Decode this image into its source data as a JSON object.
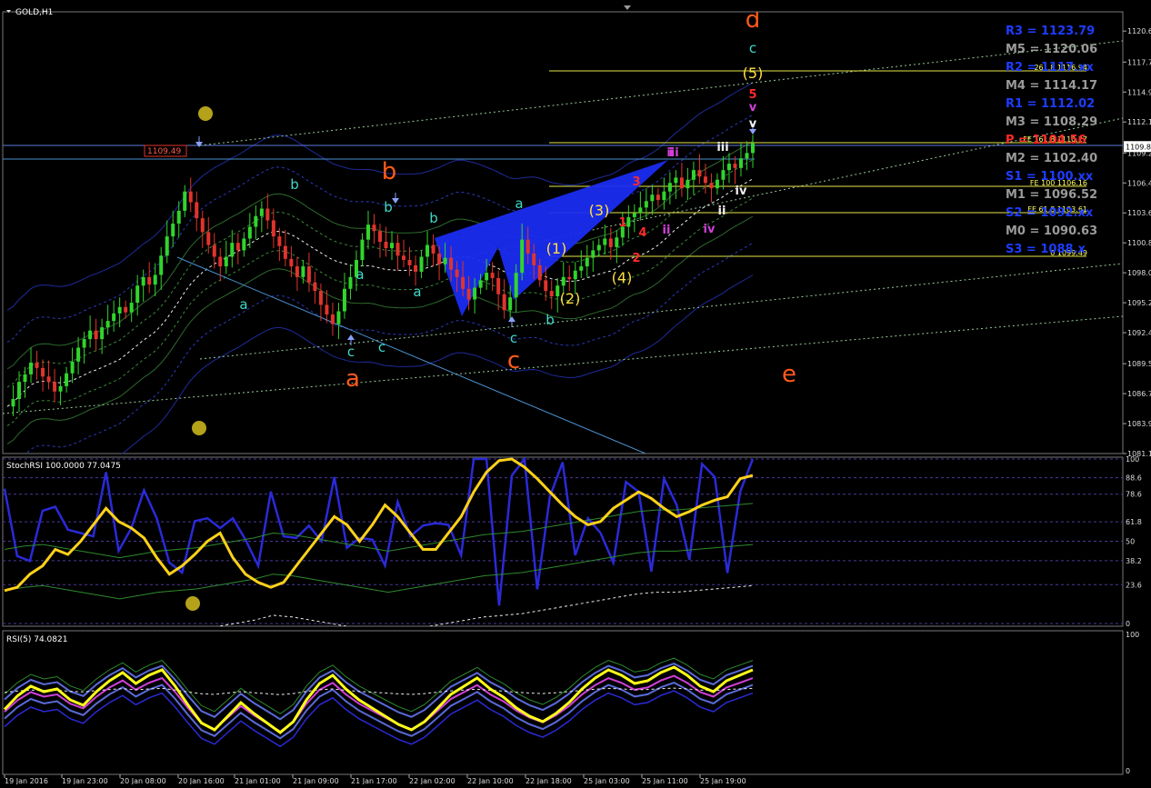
{
  "window": {
    "title": "GOLD,H1"
  },
  "chart_data": [
    {
      "type": "candlestick",
      "title": "GOLD,H1",
      "ylim": [
        1081.1,
        1122.4
      ],
      "y_ticks": [
        "1120.6",
        "1117.7",
        "1114.9",
        "1112.1",
        "1109.2",
        "1106.4",
        "1103.6",
        "1100.8",
        "1098.0",
        "1095.2",
        "1092.4",
        "1089.5",
        "1086.7",
        "1083.9",
        "1081.1"
      ],
      "current_price": "1109.8",
      "x_ticks": [
        "19 Jan 2016",
        "19 Jan 23:00",
        "20 Jan 08:00",
        "20 Jan 16:00",
        "21 Jan 01:00",
        "21 Jan 09:00",
        "21 Jan 17:00",
        "22 Jan 02:00",
        "22 Jan 10:00",
        "22 Jan 18:00",
        "25 Jan 03:00",
        "25 Jan 11:00",
        "25 Jan 19:00"
      ],
      "close_series": [
        1085.5,
        1086.2,
        1087.8,
        1088.5,
        1089.6,
        1089.1,
        1088.3,
        1087.8,
        1086.9,
        1087.4,
        1088.6,
        1089.7,
        1091.0,
        1091.8,
        1092.6,
        1091.8,
        1092.9,
        1093.5,
        1094.2,
        1094.8,
        1094.3,
        1095.2,
        1096.8,
        1097.6,
        1096.9,
        1097.8,
        1099.6,
        1101.4,
        1102.6,
        1103.8,
        1105.6,
        1104.6,
        1103.1,
        1101.8,
        1100.6,
        1099.5,
        1098.6,
        1099.5,
        1100.8,
        1100.1,
        1101.2,
        1102.3,
        1103.3,
        1104.0,
        1102.9,
        1101.4,
        1100.5,
        1099.3,
        1098.6,
        1097.6,
        1098.6,
        1097.1,
        1096.3,
        1095.0,
        1094.1,
        1093.2,
        1094.4,
        1096.5,
        1097.6,
        1099.2,
        1101.1,
        1102.5,
        1101.9,
        1100.9,
        1100.3,
        1100.8,
        1099.6,
        1099.2,
        1098.7,
        1098.1,
        1099.5,
        1100.6,
        1099.8,
        1098.8,
        1099.4,
        1098.3,
        1097.6,
        1096.5,
        1095.5,
        1096.6,
        1097.3,
        1098.0,
        1097.5,
        1096.0,
        1094.5,
        1095.7,
        1098.0,
        1101.1,
        1099.8,
        1098.7,
        1097.3,
        1096.3,
        1095.8,
        1096.8,
        1097.6,
        1097.4,
        1098.2,
        1098.6,
        1099.4,
        1100.1,
        1100.6,
        1101.2,
        1100.4,
        1101.3,
        1102.3,
        1103.2,
        1103.6,
        1104.1,
        1104.7,
        1105.3,
        1104.8,
        1105.6,
        1106.4,
        1106.9,
        1105.9,
        1106.7,
        1107.6,
        1107.0,
        1106.4,
        1105.9,
        1106.7,
        1107.6,
        1108.2,
        1107.8,
        1108.7,
        1109.2,
        1110.1
      ],
      "pivots": [
        "R3 = 1123.79",
        "M5 = 1120.06",
        "R2 = 1117.xx",
        "M4 = 1114.17",
        "R1 = 1112.02",
        "M3 = 1108.29",
        "P = 1104.56",
        "M2 = 1102.40",
        "S1 = 1100.xx",
        "M1 = 1096.52",
        "S2 = 1092.xx",
        "M0 = 1090.63",
        "S3 = 1088.x"
      ],
      "fib_levels": [
        "261.8 1116.94",
        "FE 161.8 1110.27",
        "FE 100 1106.16",
        "FE 61.8 1103.61",
        "0 1099.49"
      ],
      "price_tag": "1109.49",
      "wave_labels_major": [
        "a",
        "b",
        "c",
        "d",
        "e"
      ],
      "wave_labels_minor": [
        "a",
        "b",
        "c",
        "a",
        "b",
        "c",
        "a",
        "b",
        "c",
        "a",
        "b",
        "c"
      ],
      "wave_labels_impulse": [
        "(1)",
        "(2)",
        "(3)",
        "(4)",
        "(5)"
      ],
      "wave_labels_red": [
        "1",
        "2",
        "3",
        "4",
        "5"
      ],
      "wave_labels_roman": [
        "i",
        "ii",
        "iii",
        "iv",
        "v",
        "ii",
        "iii",
        "iv",
        "v"
      ]
    },
    {
      "type": "line",
      "title": "StochRSI 100.0000 77.0475",
      "ylim": [
        0,
        100
      ],
      "y_ticks": [
        "100",
        "88.6",
        "78.6",
        "61.8",
        "50",
        "38.2",
        "23.6",
        "0"
      ],
      "series": [
        {
          "values": [
            20,
            22,
            30,
            35,
            45,
            42,
            50,
            60,
            70,
            62,
            58,
            52,
            40,
            30,
            35,
            42,
            50,
            55,
            40,
            30,
            25,
            22,
            25,
            35,
            45,
            55,
            65,
            60,
            50,
            60,
            72,
            65,
            55,
            45,
            45,
            55,
            65,
            80,
            92,
            99,
            100,
            95,
            88,
            80,
            72,
            65,
            60,
            62,
            70,
            75,
            80,
            76,
            70,
            65,
            68,
            72,
            75,
            77,
            88,
            90
          ]
        },
        {
          "values": [
            65,
            67,
            68,
            66,
            64,
            62,
            60,
            62,
            64,
            65,
            66,
            68,
            70,
            72,
            75,
            74,
            72,
            70,
            68,
            66,
            64,
            66,
            68,
            70,
            72,
            74,
            75,
            76,
            78,
            80,
            82,
            84,
            86,
            88,
            89,
            89,
            90,
            91,
            92,
            93
          ]
        }
      ]
    },
    {
      "type": "line",
      "title": "RSI(5) 74.0821",
      "ylim": [
        0,
        100
      ],
      "y_ticks": [
        "100",
        "0"
      ],
      "series": [
        {
          "values": [
            45,
            55,
            62,
            58,
            60,
            52,
            48,
            58,
            66,
            72,
            64,
            70,
            74,
            62,
            48,
            35,
            30,
            40,
            50,
            42,
            35,
            28,
            36,
            52,
            64,
            70,
            60,
            52,
            46,
            40,
            34,
            30,
            36,
            46,
            56,
            62,
            68,
            60,
            54,
            46,
            40,
            36,
            42,
            50,
            60,
            68,
            74,
            70,
            64,
            66,
            72,
            76,
            70,
            62,
            58,
            66,
            70,
            74
          ]
        }
      ]
    }
  ],
  "colors": {
    "background": "#000000",
    "grid": "#202028",
    "bull": "#31d52c",
    "bear": "#e0342c"
  }
}
